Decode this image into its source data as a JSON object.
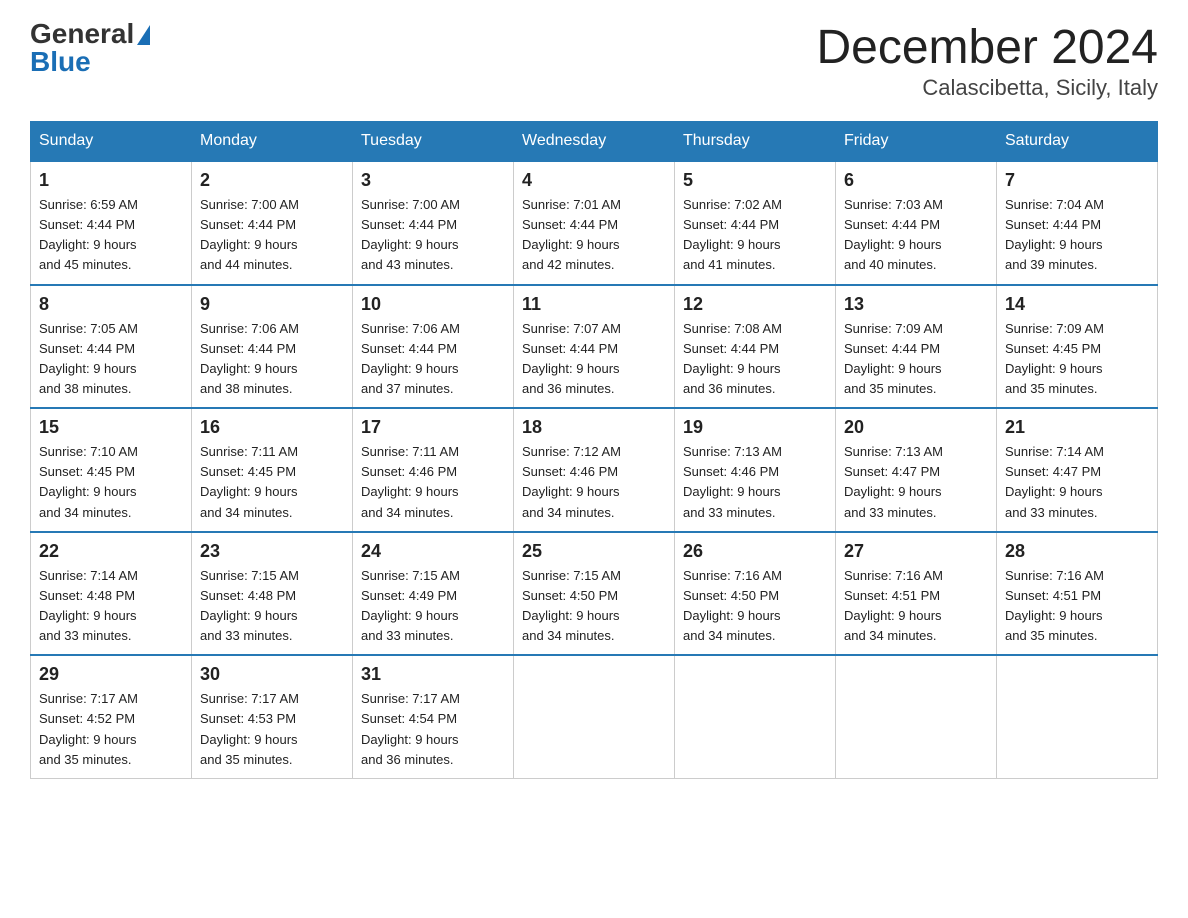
{
  "header": {
    "logo_general": "General",
    "logo_blue": "Blue",
    "title": "December 2024",
    "subtitle": "Calascibetta, Sicily, Italy"
  },
  "days_of_week": [
    "Sunday",
    "Monday",
    "Tuesday",
    "Wednesday",
    "Thursday",
    "Friday",
    "Saturday"
  ],
  "weeks": [
    [
      {
        "num": "1",
        "sunrise": "6:59 AM",
        "sunset": "4:44 PM",
        "daylight": "9 hours and 45 minutes."
      },
      {
        "num": "2",
        "sunrise": "7:00 AM",
        "sunset": "4:44 PM",
        "daylight": "9 hours and 44 minutes."
      },
      {
        "num": "3",
        "sunrise": "7:00 AM",
        "sunset": "4:44 PM",
        "daylight": "9 hours and 43 minutes."
      },
      {
        "num": "4",
        "sunrise": "7:01 AM",
        "sunset": "4:44 PM",
        "daylight": "9 hours and 42 minutes."
      },
      {
        "num": "5",
        "sunrise": "7:02 AM",
        "sunset": "4:44 PM",
        "daylight": "9 hours and 41 minutes."
      },
      {
        "num": "6",
        "sunrise": "7:03 AM",
        "sunset": "4:44 PM",
        "daylight": "9 hours and 40 minutes."
      },
      {
        "num": "7",
        "sunrise": "7:04 AM",
        "sunset": "4:44 PM",
        "daylight": "9 hours and 39 minutes."
      }
    ],
    [
      {
        "num": "8",
        "sunrise": "7:05 AM",
        "sunset": "4:44 PM",
        "daylight": "9 hours and 38 minutes."
      },
      {
        "num": "9",
        "sunrise": "7:06 AM",
        "sunset": "4:44 PM",
        "daylight": "9 hours and 38 minutes."
      },
      {
        "num": "10",
        "sunrise": "7:06 AM",
        "sunset": "4:44 PM",
        "daylight": "9 hours and 37 minutes."
      },
      {
        "num": "11",
        "sunrise": "7:07 AM",
        "sunset": "4:44 PM",
        "daylight": "9 hours and 36 minutes."
      },
      {
        "num": "12",
        "sunrise": "7:08 AM",
        "sunset": "4:44 PM",
        "daylight": "9 hours and 36 minutes."
      },
      {
        "num": "13",
        "sunrise": "7:09 AM",
        "sunset": "4:44 PM",
        "daylight": "9 hours and 35 minutes."
      },
      {
        "num": "14",
        "sunrise": "7:09 AM",
        "sunset": "4:45 PM",
        "daylight": "9 hours and 35 minutes."
      }
    ],
    [
      {
        "num": "15",
        "sunrise": "7:10 AM",
        "sunset": "4:45 PM",
        "daylight": "9 hours and 34 minutes."
      },
      {
        "num": "16",
        "sunrise": "7:11 AM",
        "sunset": "4:45 PM",
        "daylight": "9 hours and 34 minutes."
      },
      {
        "num": "17",
        "sunrise": "7:11 AM",
        "sunset": "4:46 PM",
        "daylight": "9 hours and 34 minutes."
      },
      {
        "num": "18",
        "sunrise": "7:12 AM",
        "sunset": "4:46 PM",
        "daylight": "9 hours and 34 minutes."
      },
      {
        "num": "19",
        "sunrise": "7:13 AM",
        "sunset": "4:46 PM",
        "daylight": "9 hours and 33 minutes."
      },
      {
        "num": "20",
        "sunrise": "7:13 AM",
        "sunset": "4:47 PM",
        "daylight": "9 hours and 33 minutes."
      },
      {
        "num": "21",
        "sunrise": "7:14 AM",
        "sunset": "4:47 PM",
        "daylight": "9 hours and 33 minutes."
      }
    ],
    [
      {
        "num": "22",
        "sunrise": "7:14 AM",
        "sunset": "4:48 PM",
        "daylight": "9 hours and 33 minutes."
      },
      {
        "num": "23",
        "sunrise": "7:15 AM",
        "sunset": "4:48 PM",
        "daylight": "9 hours and 33 minutes."
      },
      {
        "num": "24",
        "sunrise": "7:15 AM",
        "sunset": "4:49 PM",
        "daylight": "9 hours and 33 minutes."
      },
      {
        "num": "25",
        "sunrise": "7:15 AM",
        "sunset": "4:50 PM",
        "daylight": "9 hours and 34 minutes."
      },
      {
        "num": "26",
        "sunrise": "7:16 AM",
        "sunset": "4:50 PM",
        "daylight": "9 hours and 34 minutes."
      },
      {
        "num": "27",
        "sunrise": "7:16 AM",
        "sunset": "4:51 PM",
        "daylight": "9 hours and 34 minutes."
      },
      {
        "num": "28",
        "sunrise": "7:16 AM",
        "sunset": "4:51 PM",
        "daylight": "9 hours and 35 minutes."
      }
    ],
    [
      {
        "num": "29",
        "sunrise": "7:17 AM",
        "sunset": "4:52 PM",
        "daylight": "9 hours and 35 minutes."
      },
      {
        "num": "30",
        "sunrise": "7:17 AM",
        "sunset": "4:53 PM",
        "daylight": "9 hours and 35 minutes."
      },
      {
        "num": "31",
        "sunrise": "7:17 AM",
        "sunset": "4:54 PM",
        "daylight": "9 hours and 36 minutes."
      },
      null,
      null,
      null,
      null
    ]
  ]
}
